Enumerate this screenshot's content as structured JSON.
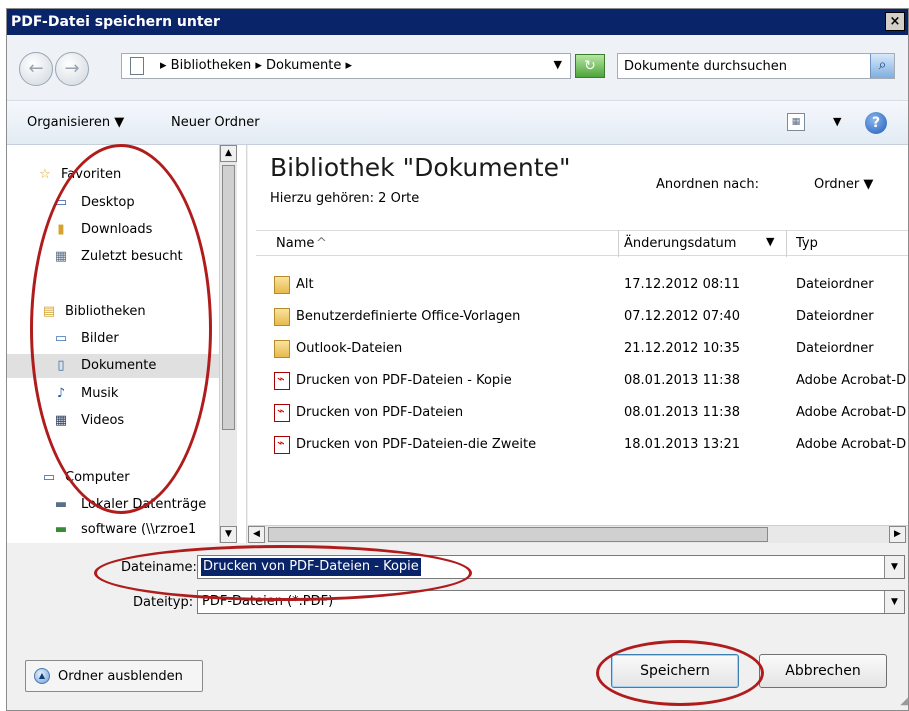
{
  "window": {
    "title": "PDF-Datei speichern unter",
    "close_glyph": "×"
  },
  "navbar": {
    "back_glyph": "←",
    "forward_glyph": "→",
    "address_path": "▸ Bibliotheken ▸ Dokumente ▸",
    "address_dropdown": "▼",
    "refresh_glyph": "↻",
    "search_placeholder": "Dokumente durchsuchen",
    "search_glyph": "⌕"
  },
  "toolbar": {
    "organize_label": "Organisieren ▼",
    "new_folder_label": "Neuer Ordner",
    "view_glyph": "▦",
    "view_dropdown": "▼",
    "help_glyph": "?"
  },
  "sidebar": {
    "items": [
      {
        "label": "Favoriten",
        "icon": "☆"
      },
      {
        "label": "Desktop",
        "icon": "▭"
      },
      {
        "label": "Downloads",
        "icon": "▮"
      },
      {
        "label": "Zuletzt besucht",
        "icon": "▦"
      },
      {
        "label": "Bibliotheken",
        "icon": "▤"
      },
      {
        "label": "Bilder",
        "icon": "▭"
      },
      {
        "label": "Dokumente",
        "icon": "▯"
      },
      {
        "label": "Musik",
        "icon": "♪"
      },
      {
        "label": "Videos",
        "icon": "▦"
      },
      {
        "label": "Computer",
        "icon": "▭"
      },
      {
        "label": "Lokaler Datenträge",
        "icon": "▬"
      },
      {
        "label": "software (\\\\rzroe1",
        "icon": "▬"
      }
    ]
  },
  "library": {
    "title": "Bibliothek \"Dokumente\"",
    "subtitle": "Hierzu gehören: 2 Orte",
    "arrange_label": "Anordnen nach:",
    "arrange_value": "Ordner ▼"
  },
  "table": {
    "columns": {
      "name": "Name",
      "date": "Änderungsdatum",
      "type": "Typ"
    },
    "sort_glyph": "^",
    "rows": [
      {
        "name": "Alt",
        "date": "17.12.2012 08:11",
        "type": "Dateiordner"
      },
      {
        "name": "Benutzerdefinierte Office-Vorlagen",
        "date": "07.12.2012 07:40",
        "type": "Dateiordner"
      },
      {
        "name": "Outlook-Dateien",
        "date": "21.12.2012 10:35",
        "type": "Dateiordner"
      },
      {
        "name": "Drucken von PDF-Dateien - Kopie",
        "date": "08.01.2013 11:38",
        "type": "Adobe Acrobat-D"
      },
      {
        "name": "Drucken von PDF-Dateien",
        "date": "08.01.2013 11:38",
        "type": "Adobe Acrobat-D"
      },
      {
        "name": "Drucken von PDF-Dateien-die Zweite",
        "date": "18.01.2013 13:21",
        "type": "Adobe Acrobat-D"
      }
    ]
  },
  "scroll": {
    "up": "▲",
    "down": "▼",
    "left": "◀",
    "right": "▶"
  },
  "form": {
    "filename_label": "Dateiname:",
    "filename_value": "Drucken von PDF-Dateien - Kopie",
    "filetype_label": "Dateityp:",
    "filetype_value": "PDF-Dateien (*.PDF)",
    "dropdown_glyph": "▼"
  },
  "footer": {
    "hide_folders_label": "Ordner ausblenden",
    "hide_folders_glyph": "▲",
    "save_label": "Speichern",
    "cancel_label": "Abbrechen"
  },
  "annotation_color": "#b01c1c"
}
